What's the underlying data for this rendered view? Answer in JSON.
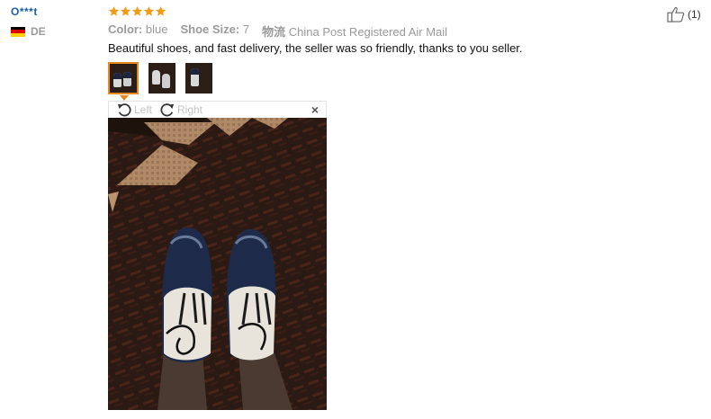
{
  "reviewer": {
    "name": "O***t",
    "country_code": "DE"
  },
  "rating": {
    "stars": 5,
    "max": 5,
    "color": "#f39c12"
  },
  "attributes": {
    "color_label": "Color:",
    "color_value": "blue",
    "size_label": "Shoe Size:",
    "size_value": "7",
    "shipping_label": "物流",
    "shipping_value": "China Post Registered Air Mail"
  },
  "review_text": "Beautiful shoes, and fast delivery, the seller was so friendly, thanks to you seller.",
  "thumbnails": [
    {
      "name": "photo-1",
      "selected": true
    },
    {
      "name": "photo-2",
      "selected": false
    },
    {
      "name": "photo-3",
      "selected": false
    }
  ],
  "viewer": {
    "rotate_left_label": "Left",
    "rotate_right_label": "Right",
    "close_icon": "close-icon",
    "close_glyph": "×"
  },
  "helpful": {
    "icon": "thumbs-up-icon",
    "count": "(1)"
  },
  "colors": {
    "name_link": "#1b5fa8",
    "selected_border": "#e58a1f",
    "muted": "#9a9a9a"
  }
}
